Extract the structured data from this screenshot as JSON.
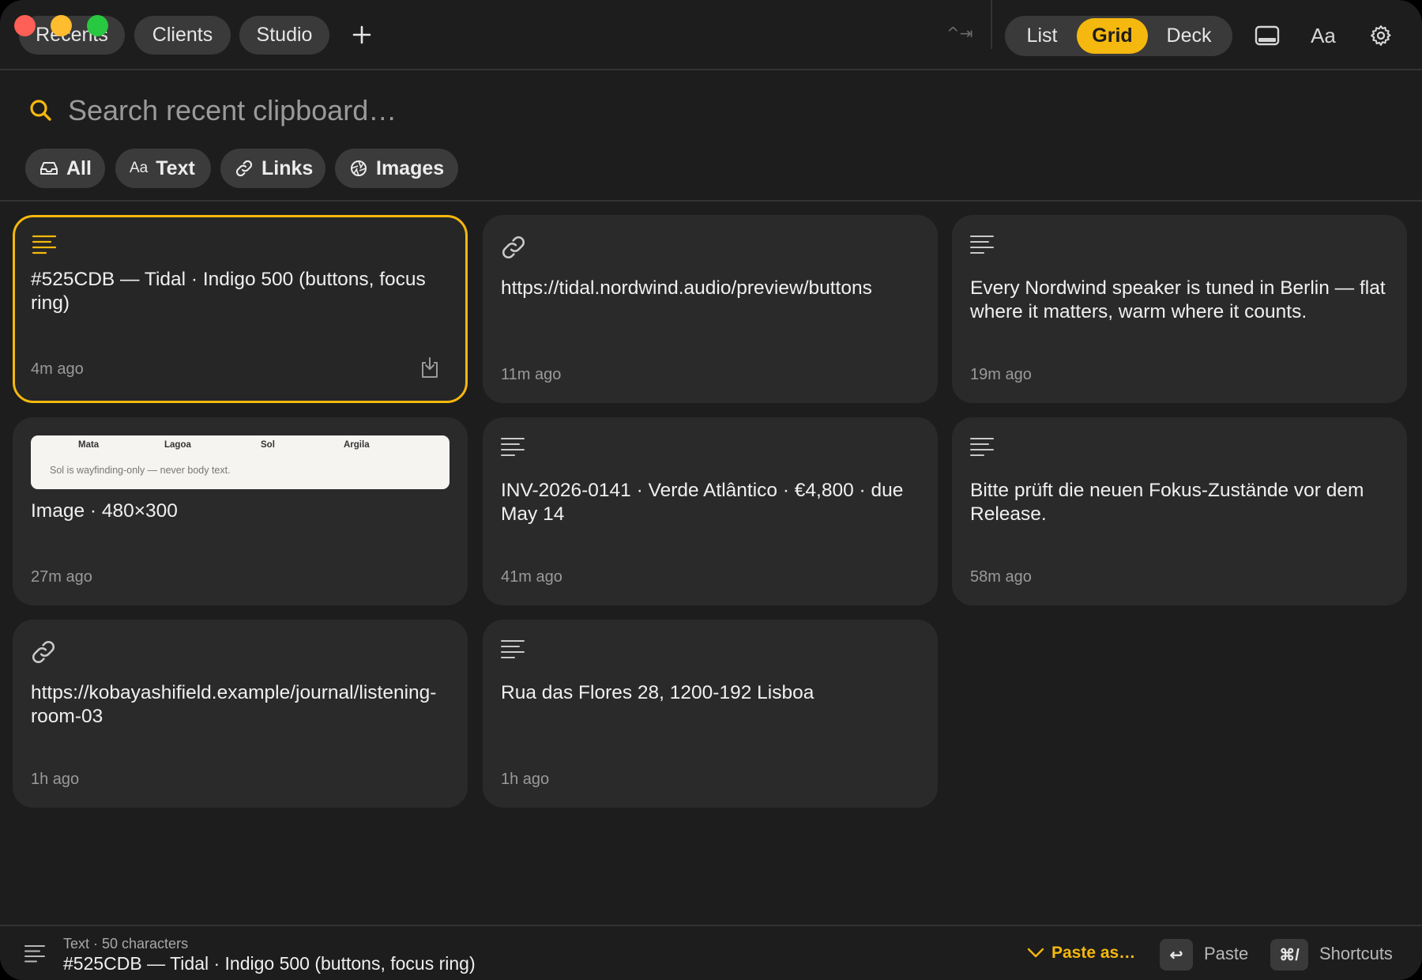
{
  "header": {
    "tabs": [
      {
        "label": "Recents"
      },
      {
        "label": "Clients"
      },
      {
        "label": "Studio"
      }
    ],
    "add_tab_icon": "plus-icon",
    "shortcut_hint": "^⇥",
    "view_modes": [
      {
        "label": "List",
        "active": false
      },
      {
        "label": "Grid",
        "active": true
      },
      {
        "label": "Deck",
        "active": false
      }
    ],
    "font_button_label": "Aa",
    "icons": [
      "panel-bottom-icon",
      "gear-icon"
    ]
  },
  "search": {
    "placeholder": "Search recent clipboard…",
    "value": ""
  },
  "filters": [
    {
      "label": "All",
      "icon": "inbox-icon"
    },
    {
      "label": "Text",
      "icon": "text-aa-icon",
      "icon_text": "Aa"
    },
    {
      "label": "Links",
      "icon": "link-icon"
    },
    {
      "label": "Images",
      "icon": "aperture-icon"
    }
  ],
  "cards": [
    {
      "type": "text",
      "content": "#525CDB — Tidal · Indigo 500 (buttons, focus ring)",
      "time": "4m ago",
      "selected": true
    },
    {
      "type": "link",
      "content": "https://tidal.nordwind.audio/preview/buttons",
      "time": "11m ago"
    },
    {
      "type": "text",
      "content": "Every Nordwind speaker is tuned in Berlin — flat where it matters, warm where it counts.",
      "time": "19m ago"
    },
    {
      "type": "image",
      "content": "Image · 480×300",
      "time": "27m ago",
      "thumbnail": {
        "columns": [
          "Mata",
          "Lagoa",
          "Sol",
          "Argila"
        ],
        "note": "Sol is wayfinding-only — never body text."
      }
    },
    {
      "type": "text",
      "content": "INV-2026-0141 · Verde Atlântico · €4,800 · due May 14",
      "time": "41m ago"
    },
    {
      "type": "text",
      "content": "Bitte prüft die neuen Fokus-Zustände vor dem Release.",
      "time": "58m ago"
    },
    {
      "type": "link",
      "content": "https://kobayashifield.example/journal/listening-room-03",
      "time": "1h ago"
    },
    {
      "type": "text",
      "content": "Rua das Flores 28, 1200-192 Lisboa",
      "time": "1h ago"
    }
  ],
  "footer": {
    "meta": "Text · 50 characters",
    "preview": "#525CDB — Tidal · Indigo 500 (buttons, focus ring)",
    "paste_as_label": "Paste as…",
    "paste_key": "↩",
    "paste_label": "Paste",
    "shortcuts_key": "⌘/",
    "shortcuts_label": "Shortcuts"
  },
  "colors": {
    "accent": "#f5b80e",
    "background": "#1d1d1d",
    "card": "#2a2a2a",
    "traffic_close": "#fe5f57",
    "traffic_minimize": "#febc2e",
    "traffic_zoom": "#28c840"
  }
}
